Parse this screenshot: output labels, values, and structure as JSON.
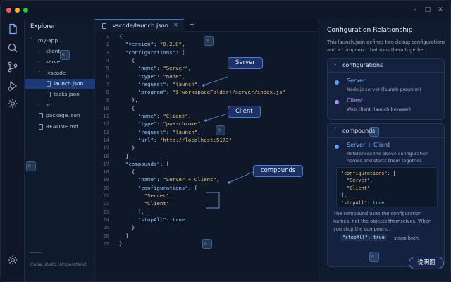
{
  "window": {
    "traffic_lights": [
      "#ff5f57",
      "#febc2e",
      "#28c840"
    ],
    "controls": [
      "–",
      "□",
      "✕"
    ]
  },
  "activity_bar": {
    "icons": [
      "files-icon",
      "search-icon",
      "source-control-icon",
      "run-debug-icon",
      "extensions-icon",
      "settings-icon"
    ]
  },
  "explorer": {
    "title": "Explorer",
    "tree": [
      {
        "label": "my-app",
        "chev": "˅",
        "kind": "folder",
        "depth": 0
      },
      {
        "label": "client",
        "chev": "›",
        "kind": "folder",
        "depth": 1
      },
      {
        "label": "server",
        "chev": "›",
        "kind": "folder",
        "depth": 1
      },
      {
        "label": ".vscode",
        "chev": "˅",
        "kind": "folder",
        "depth": 1
      },
      {
        "label": "launch.json",
        "chev": "",
        "kind": "file",
        "depth": 2,
        "active": true
      },
      {
        "label": "tasks.json",
        "chev": "",
        "kind": "file",
        "depth": 2
      },
      {
        "label": "src",
        "chev": "›",
        "kind": "folder",
        "depth": 1
      },
      {
        "label": "package.json",
        "chev": "",
        "kind": "file",
        "depth": 1
      },
      {
        "label": "README.md",
        "chev": "",
        "kind": "file",
        "depth": 1
      }
    ],
    "footer": "Code. Build. Understand."
  },
  "editor": {
    "tab_label": ".vscode/launch.json",
    "tab_close": "✕",
    "tab_add": "+",
    "lines": [
      [
        [
          "{",
          "p"
        ]
      ],
      [
        [
          "  ",
          "p"
        ],
        [
          "\"version\"",
          "k"
        ],
        [
          ": ",
          "p"
        ],
        [
          "\"0.2.0\"",
          "s"
        ],
        [
          ",",
          "p"
        ]
      ],
      [
        [
          "  ",
          "p"
        ],
        [
          "\"configurations\"",
          "k"
        ],
        [
          ": [",
          "p"
        ]
      ],
      [
        [
          "    {",
          "p"
        ]
      ],
      [
        [
          "      ",
          "p"
        ],
        [
          "\"name\"",
          "k"
        ],
        [
          ": ",
          "p"
        ],
        [
          "\"Server\"",
          "s"
        ],
        [
          ",",
          "p"
        ]
      ],
      [
        [
          "      ",
          "p"
        ],
        [
          "\"type\"",
          "k"
        ],
        [
          ": ",
          "p"
        ],
        [
          "\"node\"",
          "s"
        ],
        [
          ",",
          "p"
        ]
      ],
      [
        [
          "      ",
          "p"
        ],
        [
          "\"request\"",
          "k"
        ],
        [
          ": ",
          "p"
        ],
        [
          "\"launch\"",
          "s"
        ],
        [
          ",",
          "p"
        ]
      ],
      [
        [
          "      ",
          "p"
        ],
        [
          "\"program\"",
          "k"
        ],
        [
          ": ",
          "p"
        ],
        [
          "\"${workspaceFolder}/server/index.js\"",
          "s"
        ]
      ],
      [
        [
          "    },",
          "p"
        ]
      ],
      [
        [
          "    {",
          "p"
        ]
      ],
      [
        [
          "      ",
          "p"
        ],
        [
          "\"name\"",
          "k"
        ],
        [
          ": ",
          "p"
        ],
        [
          "\"Client\"",
          "s"
        ],
        [
          ",",
          "p"
        ]
      ],
      [
        [
          "      ",
          "p"
        ],
        [
          "\"type\"",
          "k"
        ],
        [
          ": ",
          "p"
        ],
        [
          "\"pwa-chrome\"",
          "s"
        ],
        [
          ",",
          "p"
        ]
      ],
      [
        [
          "      ",
          "p"
        ],
        [
          "\"request\"",
          "k"
        ],
        [
          ": ",
          "p"
        ],
        [
          "\"launch\"",
          "s"
        ],
        [
          ",",
          "p"
        ]
      ],
      [
        [
          "      ",
          "p"
        ],
        [
          "\"url\"",
          "k"
        ],
        [
          ": ",
          "p"
        ],
        [
          "\"http://localhost:5173\"",
          "s"
        ]
      ],
      [
        [
          "    }",
          "p"
        ]
      ],
      [
        [
          "  ],",
          "p"
        ]
      ],
      [
        [
          "  ",
          "p"
        ],
        [
          "\"compounds\"",
          "k"
        ],
        [
          ": [",
          "p"
        ]
      ],
      [
        [
          "    {",
          "p"
        ]
      ],
      [
        [
          "      ",
          "p"
        ],
        [
          "\"name\"",
          "k"
        ],
        [
          ": ",
          "p"
        ],
        [
          "\"Server + Client\"",
          "s"
        ],
        [
          ",",
          "p"
        ]
      ],
      [
        [
          "      ",
          "p"
        ],
        [
          "\"configurations\"",
          "k"
        ],
        [
          ": [",
          "p"
        ]
      ],
      [
        [
          "        ",
          "p"
        ],
        [
          "\"Server\"",
          "s"
        ],
        [
          ",",
          "p"
        ]
      ],
      [
        [
          "        ",
          "p"
        ],
        [
          "\"Client\"",
          "s"
        ]
      ],
      [
        [
          "      ],",
          "p"
        ]
      ],
      [
        [
          "      ",
          "p"
        ],
        [
          "\"stopAll\"",
          "k"
        ],
        [
          ": ",
          "p"
        ],
        [
          "true",
          "b"
        ]
      ],
      [
        [
          "    }",
          "p"
        ]
      ],
      [
        [
          "  ]",
          "p"
        ]
      ],
      [
        [
          "}",
          "p"
        ]
      ]
    ],
    "callouts": {
      "server": "Server",
      "client": "Client",
      "compounds": "compounds"
    }
  },
  "right_panel": {
    "title": "Configuration Relationship",
    "description": "This launch.json defines two debug configurations and a compound that runs them together.",
    "configurations_card": {
      "chev": "›",
      "title": "configurations",
      "items": [
        {
          "name": "Server",
          "desc": "Node.js server (launch program)",
          "color": "#5b9cff"
        },
        {
          "name": "Client",
          "desc": "Web client (launch browser)",
          "color": "#b58cff"
        }
      ]
    },
    "compounds_card": {
      "chev": "˅",
      "title": "compounds",
      "item": {
        "name": "Server + Client",
        "desc": "References the above configuration names and starts them together.",
        "color": "#5b9cff"
      },
      "snippet": [
        [
          [
            "\"configurations\"",
            "s"
          ],
          [
            ": [",
            "p"
          ]
        ],
        [
          [
            "  \"Server\"",
            "s"
          ],
          [
            ",",
            "p"
          ]
        ],
        [
          [
            "  \"Client\"",
            "s"
          ]
        ],
        [
          [
            "],",
            "p"
          ]
        ],
        [
          [
            "\"stopAll\"",
            "s"
          ],
          [
            ": ",
            "p"
          ],
          [
            "true",
            "b"
          ]
        ]
      ],
      "note": "The compound uses the configuration names, not the objects themselves. When you stop the compound,",
      "note_code": "\"stopAll\": true",
      "note_tail": "stops both."
    },
    "help_button": "说明图"
  }
}
